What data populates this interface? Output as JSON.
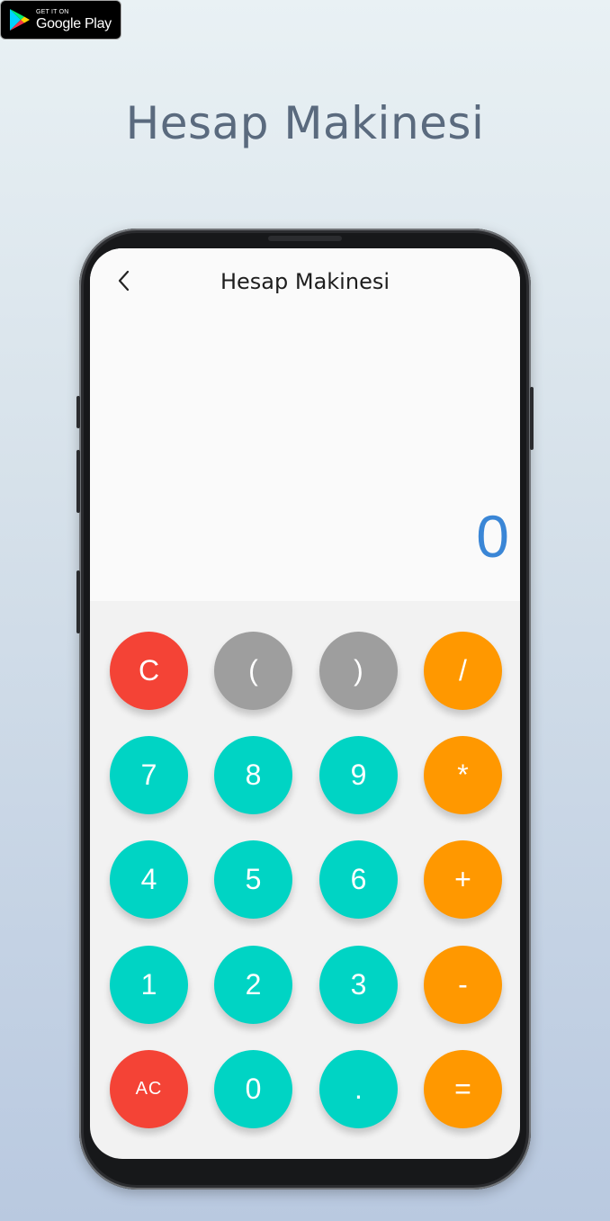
{
  "badge": {
    "line1": "GET IT ON",
    "line2": "Google Play"
  },
  "page_title": "Hesap Makinesi",
  "app": {
    "title": "Hesap Makinesi",
    "back_icon": "chevron-left-icon",
    "display": "0"
  },
  "colors": {
    "display": "#3a86d6",
    "red": "#f44336",
    "grey": "#9e9e9e",
    "orange": "#ff9800",
    "teal": "#00d4c4"
  },
  "keys": {
    "c": "C",
    "lparen": "(",
    "rparen": ")",
    "divide": "/",
    "seven": "7",
    "eight": "8",
    "nine": "9",
    "multiply": "*",
    "four": "4",
    "five": "5",
    "six": "6",
    "plus": "+",
    "one": "1",
    "two": "2",
    "three": "3",
    "minus": "-",
    "ac": "AC",
    "zero": "0",
    "dot": ".",
    "equals": "="
  }
}
